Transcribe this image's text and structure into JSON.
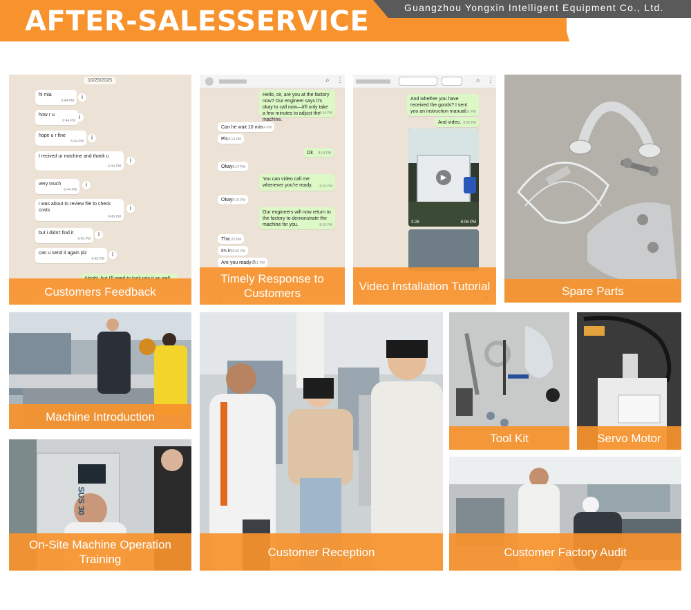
{
  "header": {
    "title": "AFTER-SALESSERVICE",
    "company": "Guangzhou Yongxin Intelligent Equipment Co., Ltd."
  },
  "colors": {
    "accent": "#f7922d",
    "company_band": "#5a5a5a",
    "chat_in": "#ffffff",
    "chat_out": "#dcf8c6"
  },
  "tiles": {
    "feedback": {
      "caption": "Customers Feedback",
      "date": "10/25/2025",
      "messages": [
        {
          "text": "hi mia",
          "time": "6:44 PM"
        },
        {
          "text": "how r u",
          "time": "6:44 PM"
        },
        {
          "text": "hope u r fine",
          "time": "6:44 PM"
        },
        {
          "text": "I recived ur machine and thank u",
          "time": "6:44 PM"
        },
        {
          "text": "very much",
          "time": "6:44 PM"
        },
        {
          "text": "i was about to review file to check costs",
          "time": "6:45 PM"
        },
        {
          "text": "but i didn't find it",
          "time": "6:45 PM"
        },
        {
          "text": "can u send it again plz",
          "time": "6:45 PM"
        }
      ],
      "partial_reply": "Alright, but I'll need to look into it as well"
    },
    "response": {
      "caption": "Timely Response to Customers",
      "messages": [
        {
          "text": "Hello, sir, are you at the factory now? Our engineer says it's okay to call now—it'll only take a few minutes to adjust the machine.",
          "time": "8:14 PM",
          "dir": "out"
        },
        {
          "text": "Can he wait 10 min",
          "time": "8:14 PM",
          "dir": "in"
        },
        {
          "text": "Pls",
          "time": "8:14 PM",
          "dir": "in"
        },
        {
          "text": "Ok",
          "time": "8:14 PM",
          "dir": "out"
        },
        {
          "text": "Okay",
          "time": "8:14 PM",
          "dir": "in"
        },
        {
          "text": "You can video call me whenever you're ready.",
          "time": "8:15 PM",
          "dir": "out"
        },
        {
          "text": "Okay",
          "time": "8:15 PM",
          "dir": "in"
        },
        {
          "text": "Our engineers will now return to the factory to demonstrate the machine for you.",
          "time": "8:16 PM",
          "dir": "out"
        },
        {
          "text": "Thx",
          "time": "8:20 PM",
          "dir": "in"
        },
        {
          "text": "Im in",
          "time": "8:30 PM",
          "dir": "in"
        },
        {
          "text": "Are you ready ?",
          "time": "8:31 PM",
          "dir": "in"
        }
      ]
    },
    "video": {
      "caption": "Video Installation Tutorial",
      "messages": [
        {
          "text": "And whether you have received the goods? I sent you an instruction manual.",
          "time": "8:01 PM"
        },
        {
          "text": "And video.",
          "time": "8:02 PM"
        }
      ],
      "video_duration": "3:28",
      "video_time": "8:06 PM"
    },
    "spare_parts": {
      "caption": "Spare Parts"
    },
    "machine_intro": {
      "caption": "Machine Introduction"
    },
    "reception": {
      "caption": "Customer Reception"
    },
    "tool_kit": {
      "caption": "Tool Kit"
    },
    "servo_motor": {
      "caption": "Servo Motor"
    },
    "training": {
      "caption": "On-Site Machine Operation Training",
      "machine_label": "SUS 30"
    },
    "audit": {
      "caption": "Customer Factory Audit"
    }
  }
}
